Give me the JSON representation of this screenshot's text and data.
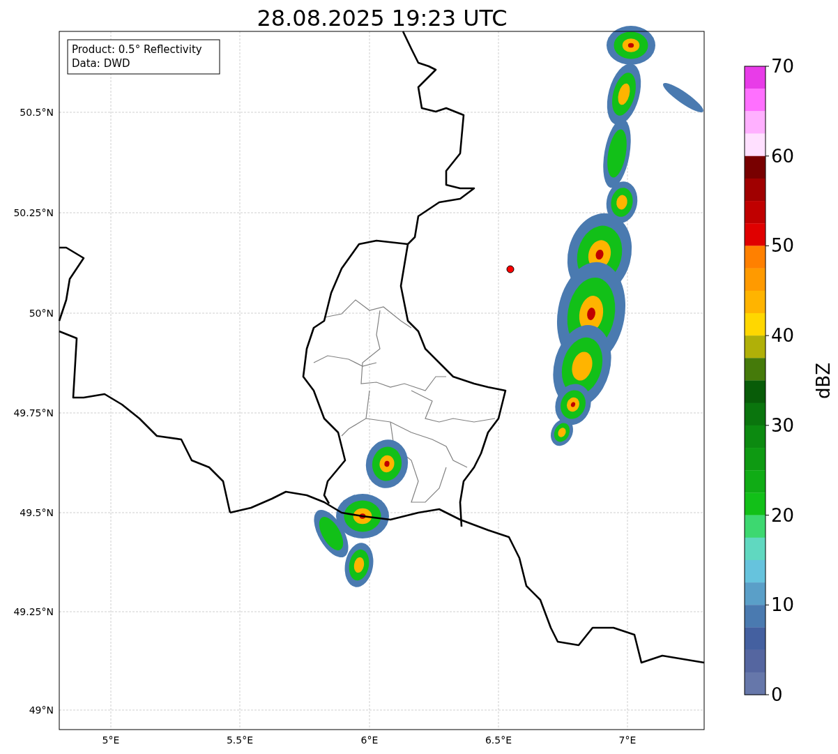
{
  "title": "28.08.2025 19:23 UTC",
  "legend": [
    "Product: 0.5° Reflectivity",
    "Data: DWD"
  ],
  "x_ticks": [
    "5°E",
    "5.5°E",
    "6°E",
    "6.5°E",
    "7°E"
  ],
  "y_ticks": [
    "50.5°N",
    "50.25°N",
    "50°N",
    "49.75°N",
    "49.5°N",
    "49.25°N",
    "49°N"
  ],
  "colorbar": {
    "label": "dBZ",
    "ticks": [
      "70",
      "60",
      "50",
      "40",
      "30",
      "20",
      "10",
      "0"
    ],
    "bins": [
      {
        "color": "#e83ce8"
      },
      {
        "color": "#ff70ff"
      },
      {
        "color": "#ffb0ff"
      },
      {
        "color": "#ffe0ff"
      },
      {
        "color": "#780000"
      },
      {
        "color": "#a00000"
      },
      {
        "color": "#c00000"
      },
      {
        "color": "#e00000"
      },
      {
        "color": "#ff8000"
      },
      {
        "color": "#ff9a00"
      },
      {
        "color": "#ffb400"
      },
      {
        "color": "#ffd700"
      },
      {
        "color": "#b0b008"
      },
      {
        "color": "#457a0a"
      },
      {
        "color": "#085c08"
      },
      {
        "color": "#0a750d"
      },
      {
        "color": "#0c8a10"
      },
      {
        "color": "#0e9a12"
      },
      {
        "color": "#10ac15"
      },
      {
        "color": "#12c018"
      },
      {
        "color": "#3dd870"
      },
      {
        "color": "#60d8c0"
      },
      {
        "color": "#66c3dd"
      },
      {
        "color": "#5a9fc8"
      },
      {
        "color": "#4a7ab0"
      },
      {
        "color": "#4460a0"
      },
      {
        "color": "#5566a0"
      },
      {
        "color": "#6677aa"
      }
    ]
  }
}
